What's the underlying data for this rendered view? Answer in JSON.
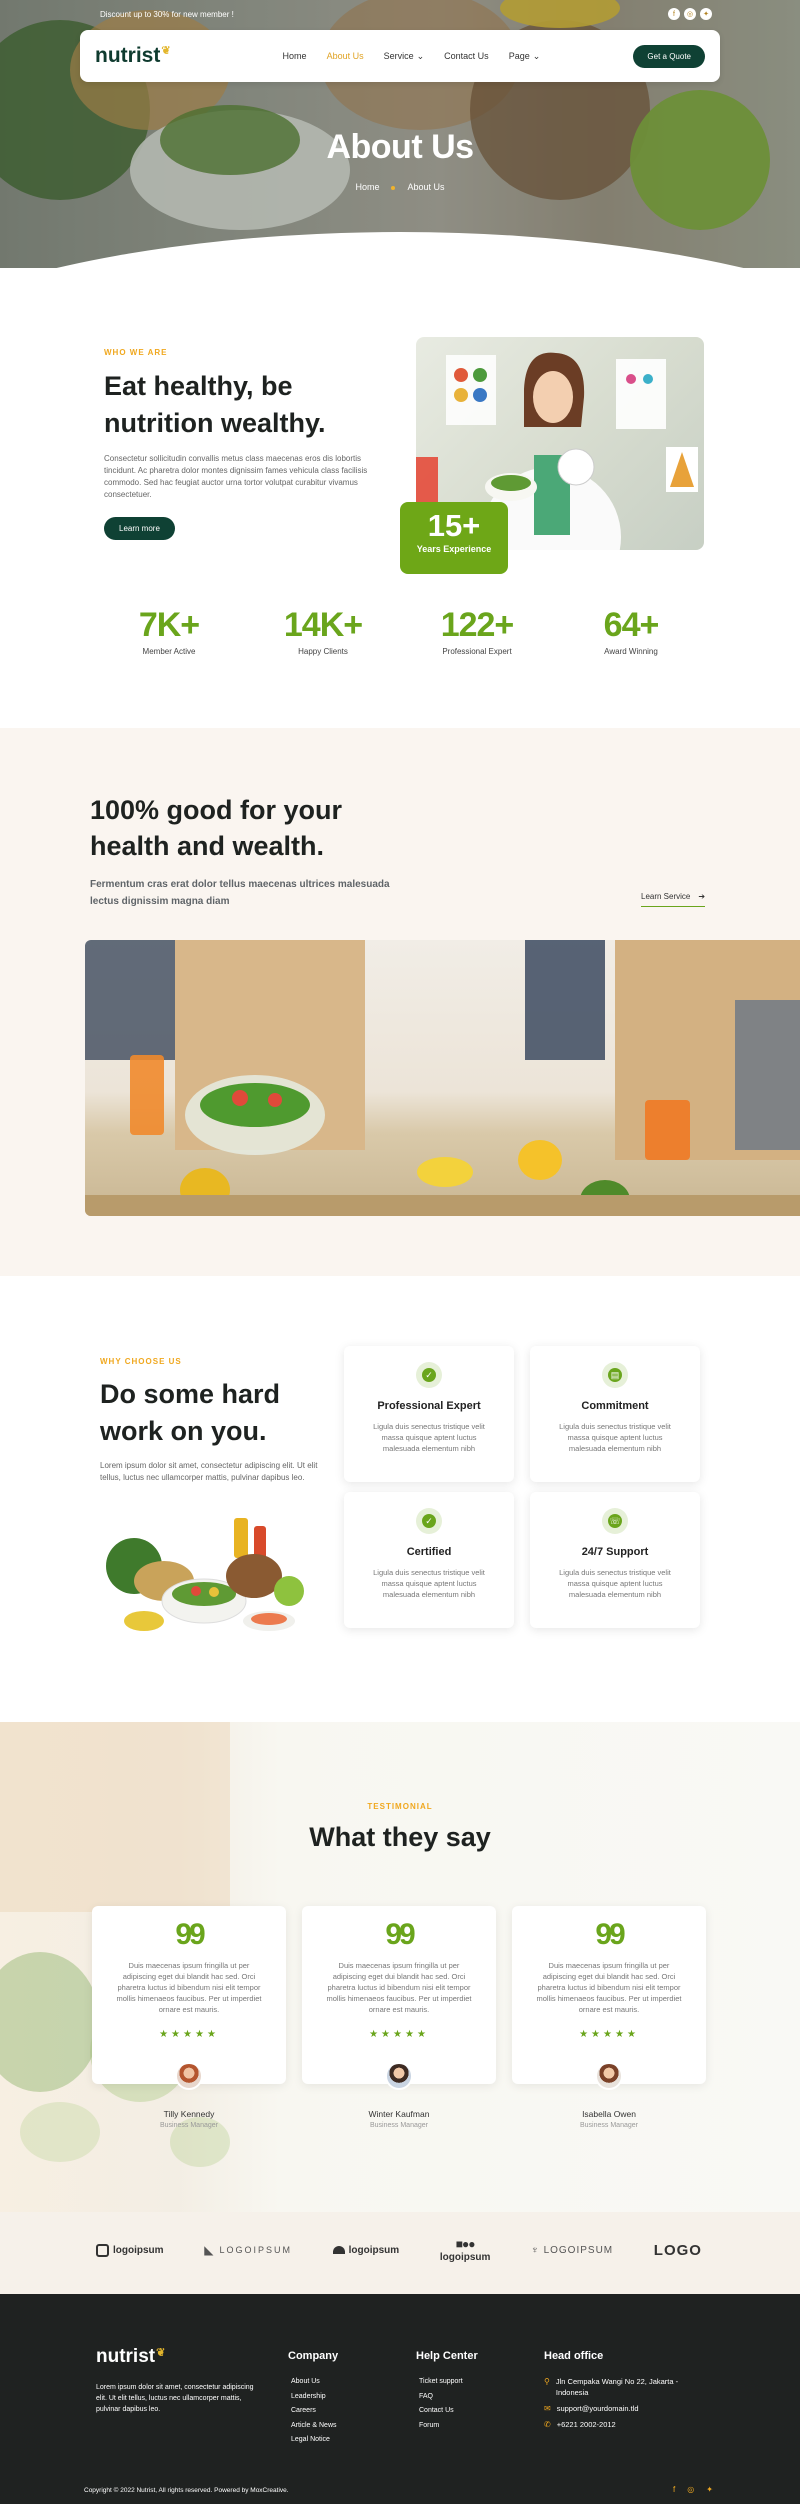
{
  "topbar": {
    "promo": "Discount up to 30% for new member !"
  },
  "brand": {
    "name": "nutrist",
    "accent": "#6aa51c",
    "dark": "#0f4134",
    "highlight": "#f0a81f"
  },
  "nav": {
    "items": [
      {
        "label": "Home",
        "active": false,
        "dropdown": false
      },
      {
        "label": "About Us",
        "active": true,
        "dropdown": false
      },
      {
        "label": "Service",
        "active": false,
        "dropdown": true
      },
      {
        "label": "Contact Us",
        "active": false,
        "dropdown": false
      },
      {
        "label": "Page",
        "active": false,
        "dropdown": true
      }
    ],
    "cta": "Get a Quote"
  },
  "hero": {
    "title": "About Us",
    "breadcrumb": [
      "Home",
      "About Us"
    ]
  },
  "about": {
    "eyebrow": "WHO WE ARE",
    "heading": "Eat healthy, be nutrition wealthy.",
    "paragraph": "Consectetur sollicitudin convallis metus class maecenas eros dis lobortis tincidunt. Ac pharetra dolor montes dignissim fames vehicula class facilisis commodo. Sed hac feugiat auctor urna tortor volutpat curabitur vivamus consectetuer.",
    "button": "Learn more",
    "badge": {
      "number": "15+",
      "label": "Years Experience"
    }
  },
  "stats": [
    {
      "value": "7K+",
      "label": "Member Active"
    },
    {
      "value": "14K+",
      "label": "Happy Clients"
    },
    {
      "value": "122+",
      "label": "Professional Expert"
    },
    {
      "value": "64+",
      "label": "Award Winning"
    }
  ],
  "good": {
    "heading": "100% good for your health and wealth.",
    "subheading": "Fermentum cras erat dolor tellus maecenas ultrices malesuada lectus dignissim magna diam",
    "link": "Learn Service"
  },
  "why": {
    "eyebrow": "WHY CHOOSE US",
    "heading": "Do some hard work on you.",
    "paragraph": "Lorem ipsum dolor sit amet, consectetur adipiscing elit. Ut elit tellus, luctus nec ullamcorper mattis, pulvinar dapibus leo.",
    "cards": [
      {
        "icon": "check-shield-icon",
        "title": "Professional Expert",
        "text": "Ligula duis senectus tristique velit massa quisque aptent luctus malesuada elementum nibh"
      },
      {
        "icon": "chart-icon",
        "title": "Commitment",
        "text": "Ligula duis senectus tristique velit massa quisque aptent luctus malesuada elementum nibh"
      },
      {
        "icon": "certified-icon",
        "title": "Certified",
        "text": "Ligula duis senectus tristique velit massa quisque aptent luctus malesuada elementum nibh"
      },
      {
        "icon": "support-icon",
        "title": "24/7 Support",
        "text": "Ligula duis senectus tristique velit massa quisque aptent luctus malesuada elementum nibh"
      }
    ]
  },
  "testimonial": {
    "eyebrow": "TESTIMONIAL",
    "heading": "What they say",
    "quote_mark": "99",
    "stars": "★★★★★",
    "items": [
      {
        "text": "Duis maecenas ipsum fringilla ut per adipiscing eget dui blandit hac sed. Orci pharetra luctus id bibendum nisi elit tempor mollis himenaeos faucibus. Per ut imperdiet ornare est mauris.",
        "name": "Tilly Kennedy",
        "role": "Business Manager"
      },
      {
        "text": "Duis maecenas ipsum fringilla ut per adipiscing eget dui blandit hac sed. Orci pharetra luctus id bibendum nisi elit tempor mollis himenaeos faucibus. Per ut imperdiet ornare est mauris.",
        "name": "Winter Kaufman",
        "role": "Business Manager"
      },
      {
        "text": "Duis maecenas ipsum fringilla ut per adipiscing eget dui blandit hac sed. Orci pharetra luctus id bibendum nisi elit tempor mollis himenaeos faucibus. Per ut imperdiet ornare est mauris.",
        "name": "Isabella Owen",
        "role": "Business Manager"
      }
    ]
  },
  "partners": [
    "logoipsum",
    "LOGOIPSUM",
    "logoipsum",
    "logoipsum",
    "LOGOIPSUM",
    "LOGO"
  ],
  "footer": {
    "description": "Lorem ipsum dolor sit amet, consectetur adipiscing elit. Ut elit tellus, luctus nec ullamcorper mattis, pulvinar dapibus leo.",
    "company": {
      "title": "Company",
      "links": [
        "About Us",
        "Leadership",
        "Careers",
        "Article & News",
        "Legal Notice"
      ]
    },
    "help": {
      "title": "Help Center",
      "links": [
        "Ticket support",
        "FAQ",
        "Contact Us",
        "Forum"
      ]
    },
    "office": {
      "title": "Head office",
      "address": "Jln Cempaka Wangi No 22, Jakarta - Indonesia",
      "email": "support@yourdomain.tld",
      "phone": "+6221 2002-2012"
    },
    "copyright": "Copyright © 2022 Nutrist, All rights reserved. Powered by MoxCreative."
  }
}
